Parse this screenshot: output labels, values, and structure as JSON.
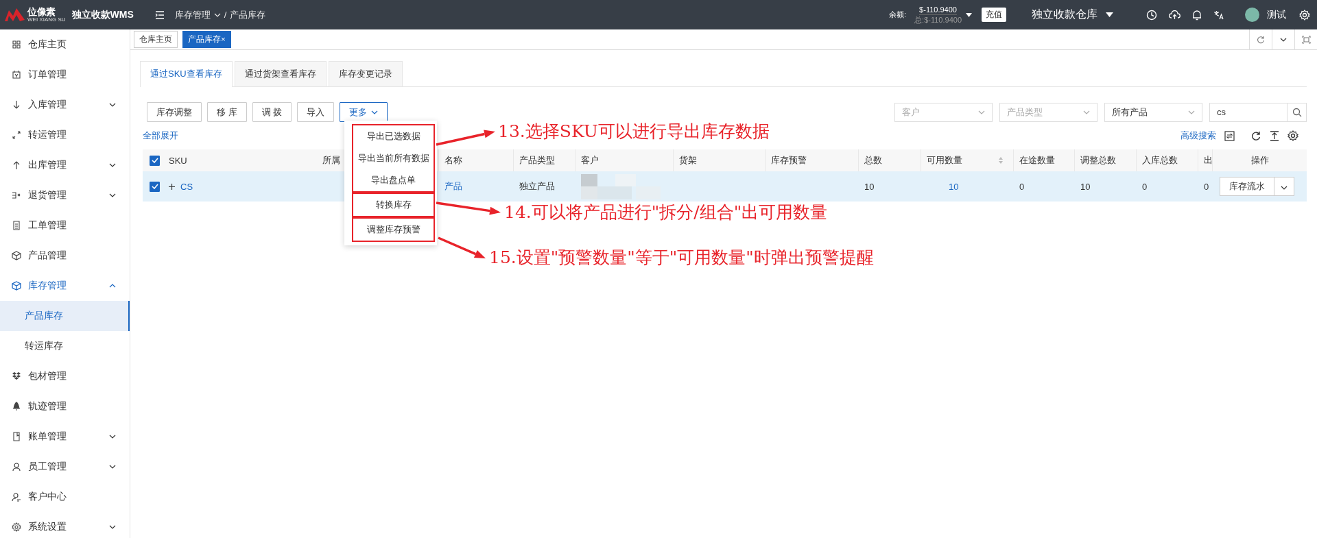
{
  "topbar": {
    "logo_text": "位像素",
    "logo_subtext": "WEI XIANG SU",
    "app_name": "独立收款WMS",
    "breadcrumb": [
      "库存管理",
      "产品库存"
    ],
    "breadcrumb_separator": "/",
    "balance_label": "余额:",
    "balance": "$-110.9400",
    "balance_total": "总:$-110.9400",
    "recharge_button": "充值",
    "warehouse": "独立收款仓库",
    "user": "测试"
  },
  "page_tabs": [
    {
      "label": "仓库主页",
      "selected": false
    },
    {
      "label": "产品库存",
      "selected": true,
      "close_glyph": "×"
    }
  ],
  "sidebar": [
    {
      "label": "仓库主页"
    },
    {
      "label": "订单管理"
    },
    {
      "label": "入库管理",
      "expanded": false
    },
    {
      "label": "转运管理"
    },
    {
      "label": "出库管理",
      "expanded": false
    },
    {
      "label": "退货管理",
      "expanded": false
    },
    {
      "label": "工单管理"
    },
    {
      "label": "产品管理"
    },
    {
      "label": "库存管理",
      "expanded": true,
      "children": [
        {
          "label": "产品库存",
          "selected": true
        },
        {
          "label": "转运库存",
          "selected": false
        }
      ]
    },
    {
      "label": "包材管理"
    },
    {
      "label": "轨迹管理"
    },
    {
      "label": "账单管理",
      "expanded": false
    },
    {
      "label": "员工管理",
      "expanded": false
    },
    {
      "label": "客户中心"
    },
    {
      "label": "系统设置",
      "expanded": false
    }
  ],
  "view_tabs": [
    {
      "label": "通过SKU查看库存",
      "selected": true
    },
    {
      "label": "通过货架查看库存",
      "selected": false
    },
    {
      "label": "库存变更记录",
      "selected": false
    }
  ],
  "toolbar_buttons": [
    {
      "label": "库存调整",
      "kind": "plain"
    },
    {
      "label": "移 库",
      "kind": "plain"
    },
    {
      "label": "调 拨",
      "kind": "plain"
    },
    {
      "label": "导入",
      "kind": "plain"
    },
    {
      "label": "更多",
      "kind": "dropdown",
      "open": true
    }
  ],
  "filters": [
    {
      "kind": "select",
      "placeholder": "客户"
    },
    {
      "kind": "select",
      "placeholder": "产品类型"
    },
    {
      "kind": "select",
      "value": "所有产品"
    },
    {
      "kind": "search",
      "value": "cs"
    }
  ],
  "expand_all_link": "全部展开",
  "advanced_search_link": "高级搜索",
  "table": {
    "all_selected": true,
    "columns": [
      {
        "label": "SKU"
      },
      {
        "label": "所属"
      },
      {
        "label": "名称"
      },
      {
        "label": "产品类型"
      },
      {
        "label": "客户"
      },
      {
        "label": "货架"
      },
      {
        "label": "库存预警"
      },
      {
        "label": "总数"
      },
      {
        "label": "可用数量",
        "sortable": true
      },
      {
        "label": "在途数量"
      },
      {
        "label": "调整总数"
      },
      {
        "label": "入库总数"
      },
      {
        "label": "出"
      },
      {
        "label": "操作"
      }
    ],
    "rows": [
      {
        "selected": true,
        "expandable": true,
        "sku": "CS",
        "product_name": "产品",
        "product_type": "独立产品",
        "customer_blurred": true,
        "total": "10",
        "available": "10",
        "in_transit": "0",
        "adjusted": "10",
        "inbound": "0",
        "outbound": "0",
        "action_button": "库存流水"
      }
    ]
  },
  "more_menu": {
    "groups": [
      {
        "highlighted": true,
        "items": [
          "导出已选数据",
          "导出当前所有数据",
          "导出盘点单"
        ]
      },
      {
        "highlighted": true,
        "items": [
          "转换库存"
        ]
      },
      {
        "highlighted": true,
        "items": [
          "调整库存预警"
        ]
      }
    ]
  },
  "annotations": [
    {
      "text": "13.选择SKU可以进行导出库存数据"
    },
    {
      "text": "14.可以将产品进行\"拆分/组合\"出可用数量"
    },
    {
      "text": "15.设置\"预警数量\"等于\"可用数量\"时弹出预警提醒"
    }
  ]
}
